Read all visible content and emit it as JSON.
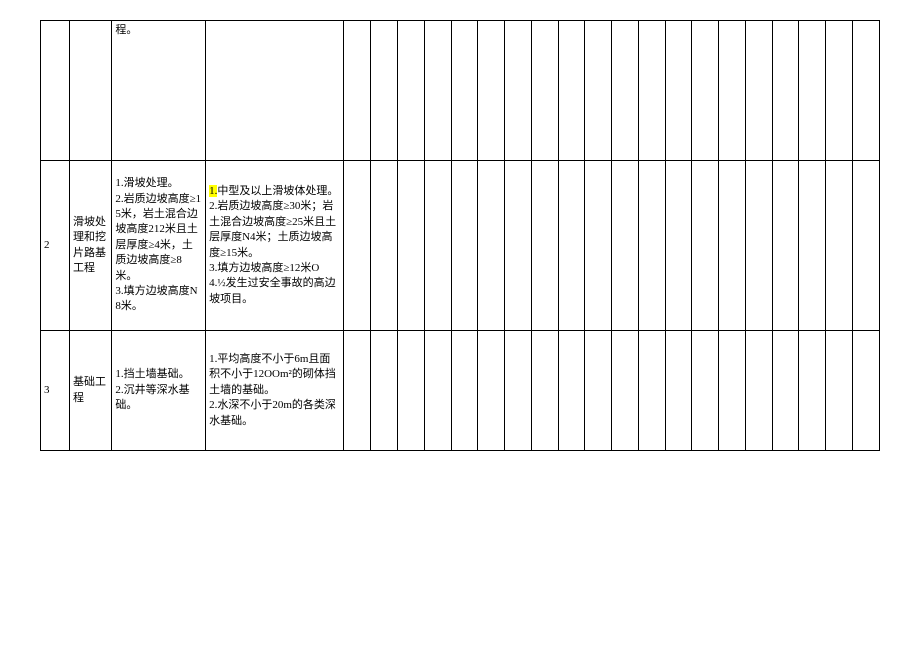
{
  "rows": [
    {
      "idx": "",
      "cat": "",
      "col1": "程。",
      "col2": ""
    },
    {
      "idx": "2",
      "cat": "滑坡处理和挖片路基工程",
      "col1": "1.滑坡处理。\n2.岩质边坡高度≥15米，岩土混合边坡高度212米且土层厚度≥4米，土质边坡高度≥8米。\n3.填方边坡高度N8米。",
      "col2_marked": "1.",
      "col2_rest": "中型及以上滑坡体处理。\n2.岩质边坡高度≥30米；岩土混合边坡高度≥25米且土层厚度N4米；土质边坡高度≥15米。\n3.填方边坡高度≥12米O\n4.½发生过安全事故的高边坡项目。"
    },
    {
      "idx": "3",
      "cat": "基础工程",
      "col1": "1.挡土墙基础。\n2.沉井等深水基础。",
      "col2": "1.平均高度不小于6m且面积不小于12OOm²的砌体挡土墙的基础。\n2.水深不小于20m的各类深水基础。"
    }
  ]
}
